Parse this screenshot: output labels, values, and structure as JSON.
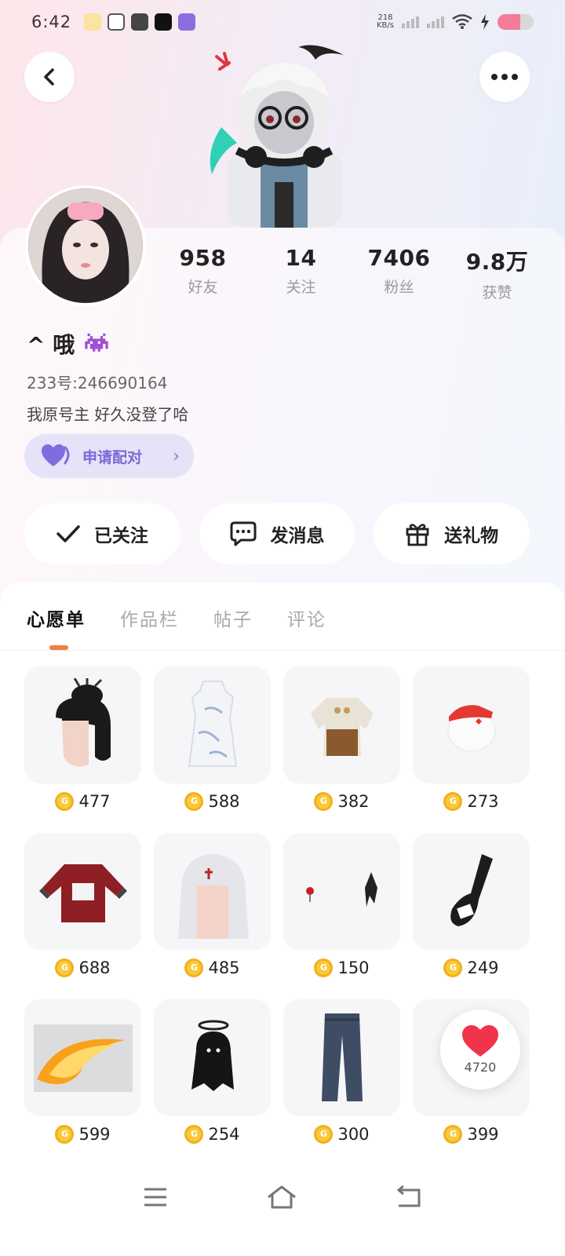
{
  "status_bar": {
    "time": "6:42",
    "net_speed_value": "218",
    "net_speed_unit": "KB/s",
    "battery_level": 0.62
  },
  "profile": {
    "nickname": "^ 哦",
    "uid": "233号:246690164",
    "bio": "我原号主 好久没登了哈",
    "pair_label": "申请配对",
    "stats": [
      {
        "value": "958",
        "label": "好友"
      },
      {
        "value": "14",
        "label": "关注"
      },
      {
        "value": "7406",
        "label": "粉丝"
      },
      {
        "value": "9.8万",
        "label": "获赞"
      }
    ]
  },
  "actions": {
    "follow_label": "已关注",
    "message_label": "发消息",
    "gift_label": "送礼物"
  },
  "tabs": [
    "心愿单",
    "作品栏",
    "帖子",
    "评论"
  ],
  "active_tab": 0,
  "wishlist": [
    {
      "icon": "hair-bun-item",
      "price": "477"
    },
    {
      "icon": "qipao-dress-item",
      "price": "588"
    },
    {
      "icon": "jacket-outfit-item",
      "price": "382"
    },
    {
      "icon": "red-cap-mask-item",
      "price": "273"
    },
    {
      "icon": "red-sweater-item",
      "price": "688"
    },
    {
      "icon": "white-hair-item",
      "price": "485"
    },
    {
      "icon": "earring-accessory-item",
      "price": "150"
    },
    {
      "icon": "guitar-bag-item",
      "price": "249"
    },
    {
      "icon": "fire-wing-effect-item",
      "price": "599"
    },
    {
      "icon": "ghost-pet-item",
      "price": "254"
    },
    {
      "icon": "jeans-item",
      "price": "300"
    },
    {
      "icon": "hidden-item",
      "price": "399"
    }
  ],
  "coin_glyph": "G",
  "like_count": "4720",
  "colors": {
    "accent_orange": "#f08140",
    "pair_purple": "#7a6ad8",
    "coin_gold": "#f9c93a",
    "heart_red": "#f0344a"
  }
}
